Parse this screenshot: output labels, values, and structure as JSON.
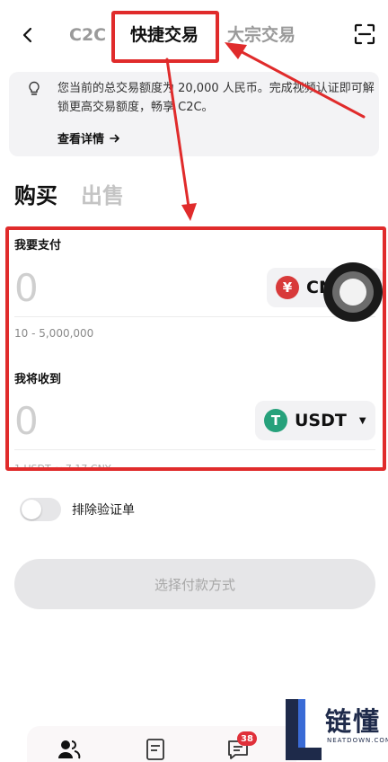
{
  "header": {
    "tabs": [
      {
        "label": "C2C"
      },
      {
        "label": "快捷交易"
      },
      {
        "label": "大宗交易"
      }
    ],
    "active_tab": "快捷交易"
  },
  "notice": {
    "text": "您当前的总交易额度为 20,000 人民币。完成视频认证即可解锁更高交易额度，畅享 C2C。",
    "link": "查看详情"
  },
  "side_tabs": {
    "buy": "购买",
    "sell": "出售",
    "active": "购买"
  },
  "pay": {
    "label": "我要支付",
    "placeholder": "0",
    "currency": "CNY",
    "currency_symbol": "¥",
    "range_hint": "10 - 5,000,000"
  },
  "receive": {
    "label": "我将收到",
    "placeholder": "0",
    "currency": "USDT",
    "currency_symbol": "T",
    "rate_hint": "1 USDT ≈ 7.17 CNY"
  },
  "exclude_verified": {
    "label": "排除验证单",
    "enabled": false
  },
  "select_payment": {
    "label": "选择付款方式"
  },
  "bottom_nav": {
    "message_badge": "38"
  },
  "watermark": {
    "text": "链懂",
    "sub": "NEATDOWN.COM"
  },
  "colors": {
    "highlight": "#e02b2b",
    "cny": "#d83a3a",
    "usdt": "#26a17b",
    "badge": "#e0303a"
  }
}
